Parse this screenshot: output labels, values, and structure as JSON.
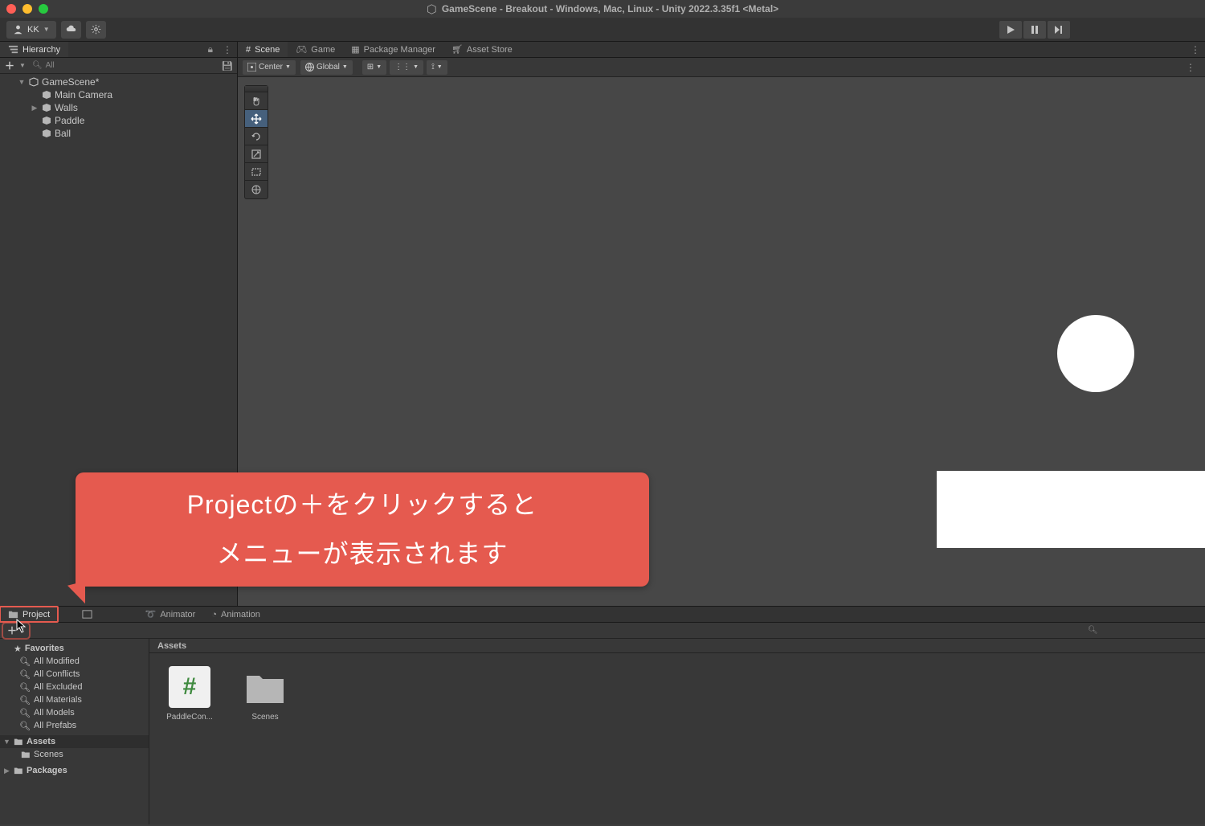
{
  "window_title": "GameScene - Breakout - Windows, Mac, Linux - Unity 2022.3.35f1 <Metal>",
  "account_label": "KK",
  "playbar": {
    "play": "▶",
    "pause": "❚❚",
    "step": "▶|"
  },
  "hierarchy": {
    "tab_label": "Hierarchy",
    "search_placeholder": "All",
    "scene_name": "GameScene*",
    "items": [
      {
        "name": "Main Camera"
      },
      {
        "name": "Walls",
        "has_children": true
      },
      {
        "name": "Paddle"
      },
      {
        "name": "Ball"
      }
    ]
  },
  "center_tabs": {
    "scene": "Scene",
    "game": "Game",
    "package_manager": "Package Manager",
    "asset_store": "Asset Store"
  },
  "scene_toolbar": {
    "pivot": "Center",
    "space": "Global"
  },
  "callout": {
    "line1": "Projectの＋をクリックすると",
    "line2": "メニューが表示されます"
  },
  "bottom_tabs": {
    "project": "Project",
    "console": "Console",
    "animator": "Animator",
    "animation": "Animation"
  },
  "project_sidebar": {
    "favorites_label": "Favorites",
    "fav_items": [
      "All Modified",
      "All Conflicts",
      "All Excluded",
      "All Materials",
      "All Models",
      "All Prefabs"
    ],
    "assets_label": "Assets",
    "assets_children": [
      "Scenes"
    ],
    "packages_label": "Packages"
  },
  "breadcrumb": "Assets",
  "assets": [
    {
      "name": "PaddleCon...",
      "kind": "script"
    },
    {
      "name": "Scenes",
      "kind": "folder"
    }
  ]
}
